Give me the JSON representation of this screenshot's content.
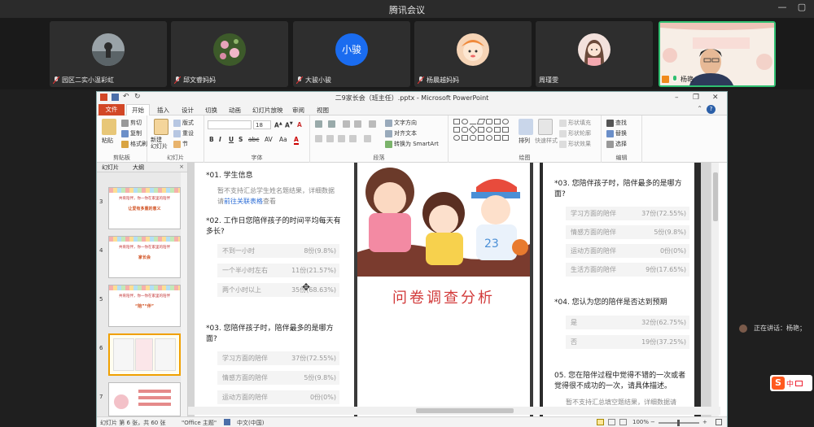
{
  "window": {
    "title": "腾讯会议"
  },
  "participants": [
    {
      "name": "园区二实小温彩虹",
      "avatar": "photo-landscape"
    },
    {
      "name": "邱文睿妈妈",
      "avatar": "photo-flowers"
    },
    {
      "name": "大骏小骏",
      "avatar_text": "小骏",
      "avatar_color": "#1a6cf0"
    },
    {
      "name": "杨晨越妈妈",
      "avatar": "cartoon-girl"
    },
    {
      "name": "周瑾雯",
      "avatar": "cartoon-woman"
    },
    {
      "name": "杨艳",
      "avatar": "video-feed",
      "active": true
    }
  ],
  "ppt": {
    "title": "二9家长会（班主任）.pptx - Microsoft PowerPoint",
    "tabs": [
      "文件",
      "开始",
      "插入",
      "设计",
      "切换",
      "动画",
      "幻灯片放映",
      "审阅",
      "视图"
    ],
    "selected_tab": "开始",
    "ribbon": {
      "clipboard": {
        "paste": "粘贴",
        "cut": "剪切",
        "copy": "复制",
        "format_painter": "格式刷",
        "label": "剪贴板"
      },
      "slides": {
        "new_slide": "新建\n幻灯片",
        "layout": "版式",
        "reset": "重设",
        "section": "节",
        "label": "幻灯片"
      },
      "font": {
        "size": "18",
        "buttons": [
          "B",
          "I",
          "U",
          "S",
          "abc",
          "AV",
          "Aa"
        ],
        "label": "字体"
      },
      "paragraph": {
        "text_direction": "文字方向",
        "align_text": "对齐文本",
        "smartart": "转换为 SmartArt",
        "label": "段落"
      },
      "drawing": {
        "arrange": "排列",
        "quick_styles": "快速样式",
        "shape_fill": "形状填充",
        "shape_outline": "形状轮廓",
        "shape_effects": "形状效果",
        "label": "绘图"
      },
      "editing": {
        "find": "查找",
        "replace": "替换",
        "select": "选择",
        "label": "编辑"
      }
    },
    "pane_tabs": {
      "slides": "幻灯片",
      "outline": "大纲"
    },
    "thumbnails": [
      {
        "num": "3",
        "title": "共育陪伴，你一你在家里的陪伴",
        "subtitle": "让爱有多重的意义"
      },
      {
        "num": "4",
        "title": "共育陪伴，你一你在家里的陪伴",
        "subtitle": "家长会"
      },
      {
        "num": "5",
        "title": "共育陪伴，你一你在家里的陪伴",
        "subtitle": "“陪”“伴”"
      },
      {
        "num": "6",
        "title": "",
        "subtitle": "",
        "selected": true
      },
      {
        "num": "7",
        "title": "",
        "subtitle": ""
      }
    ],
    "slide": {
      "left": {
        "q1": "*01. 学生信息",
        "q1_note_pre": "暂不支持汇总学生姓名题结果，详细数据请",
        "q1_note_link": "前往关联表格",
        "q1_note_post": "查看",
        "q2": "*02. 工作日您陪伴孩子的时间平均每天有多长?",
        "q2_options": [
          {
            "label": "不到一小时",
            "count": "8份(9.8%)"
          },
          {
            "label": "一个半小时左右",
            "count": "11份(21.57%)"
          },
          {
            "label": "两个小时以上",
            "count": "35份(68.63%)"
          }
        ],
        "q3": "*03. 您陪伴孩子时，陪伴最多的是哪方面?",
        "q3_options": [
          {
            "label": "学习方面的陪伴",
            "count": "37份(72.55%)"
          },
          {
            "label": "情感方面的陪伴",
            "count": "5份(9.8%)"
          },
          {
            "label": "运动方面的陪伴",
            "count": "0份(0%)"
          }
        ]
      },
      "center_title": "问卷调查分析",
      "right": {
        "q3": "*03. 您陪伴孩子时，陪伴最多的是哪方面?",
        "q3_options": [
          {
            "label": "学习方面的陪伴",
            "count": "37份(72.55%)"
          },
          {
            "label": "情感方面的陪伴",
            "count": "5份(9.8%)"
          },
          {
            "label": "运动方面的陪伴",
            "count": "0份(0%)"
          },
          {
            "label": "生活方面的陪伴",
            "count": "9份(17.65%)"
          }
        ],
        "q4": "*04. 您认为您的陪伴是否达到预期",
        "q4_options": [
          {
            "label": "是",
            "count": "32份(62.75%)"
          },
          {
            "label": "否",
            "count": "19份(37.25%)"
          }
        ],
        "q5": "05. 您在陪伴过程中觉得不错的一次或者觉得很不成功的一次，请具体描述。",
        "q5_note": "暂不支持汇总填空题结果，详细数据请"
      }
    },
    "status": {
      "slide_pos": "幻灯片 第 6 张，共 60 张",
      "theme": "\"Office 主题\"",
      "language": "中文(中国)",
      "zoom": "100%"
    }
  },
  "speaker": {
    "label": "正在讲话：杨艳；"
  },
  "ime": {
    "logo": "S",
    "mode": "中"
  },
  "colors": {
    "ppt_accent": "#d24726",
    "active_border": "#2fbf71",
    "link": "#2b6cd6"
  }
}
